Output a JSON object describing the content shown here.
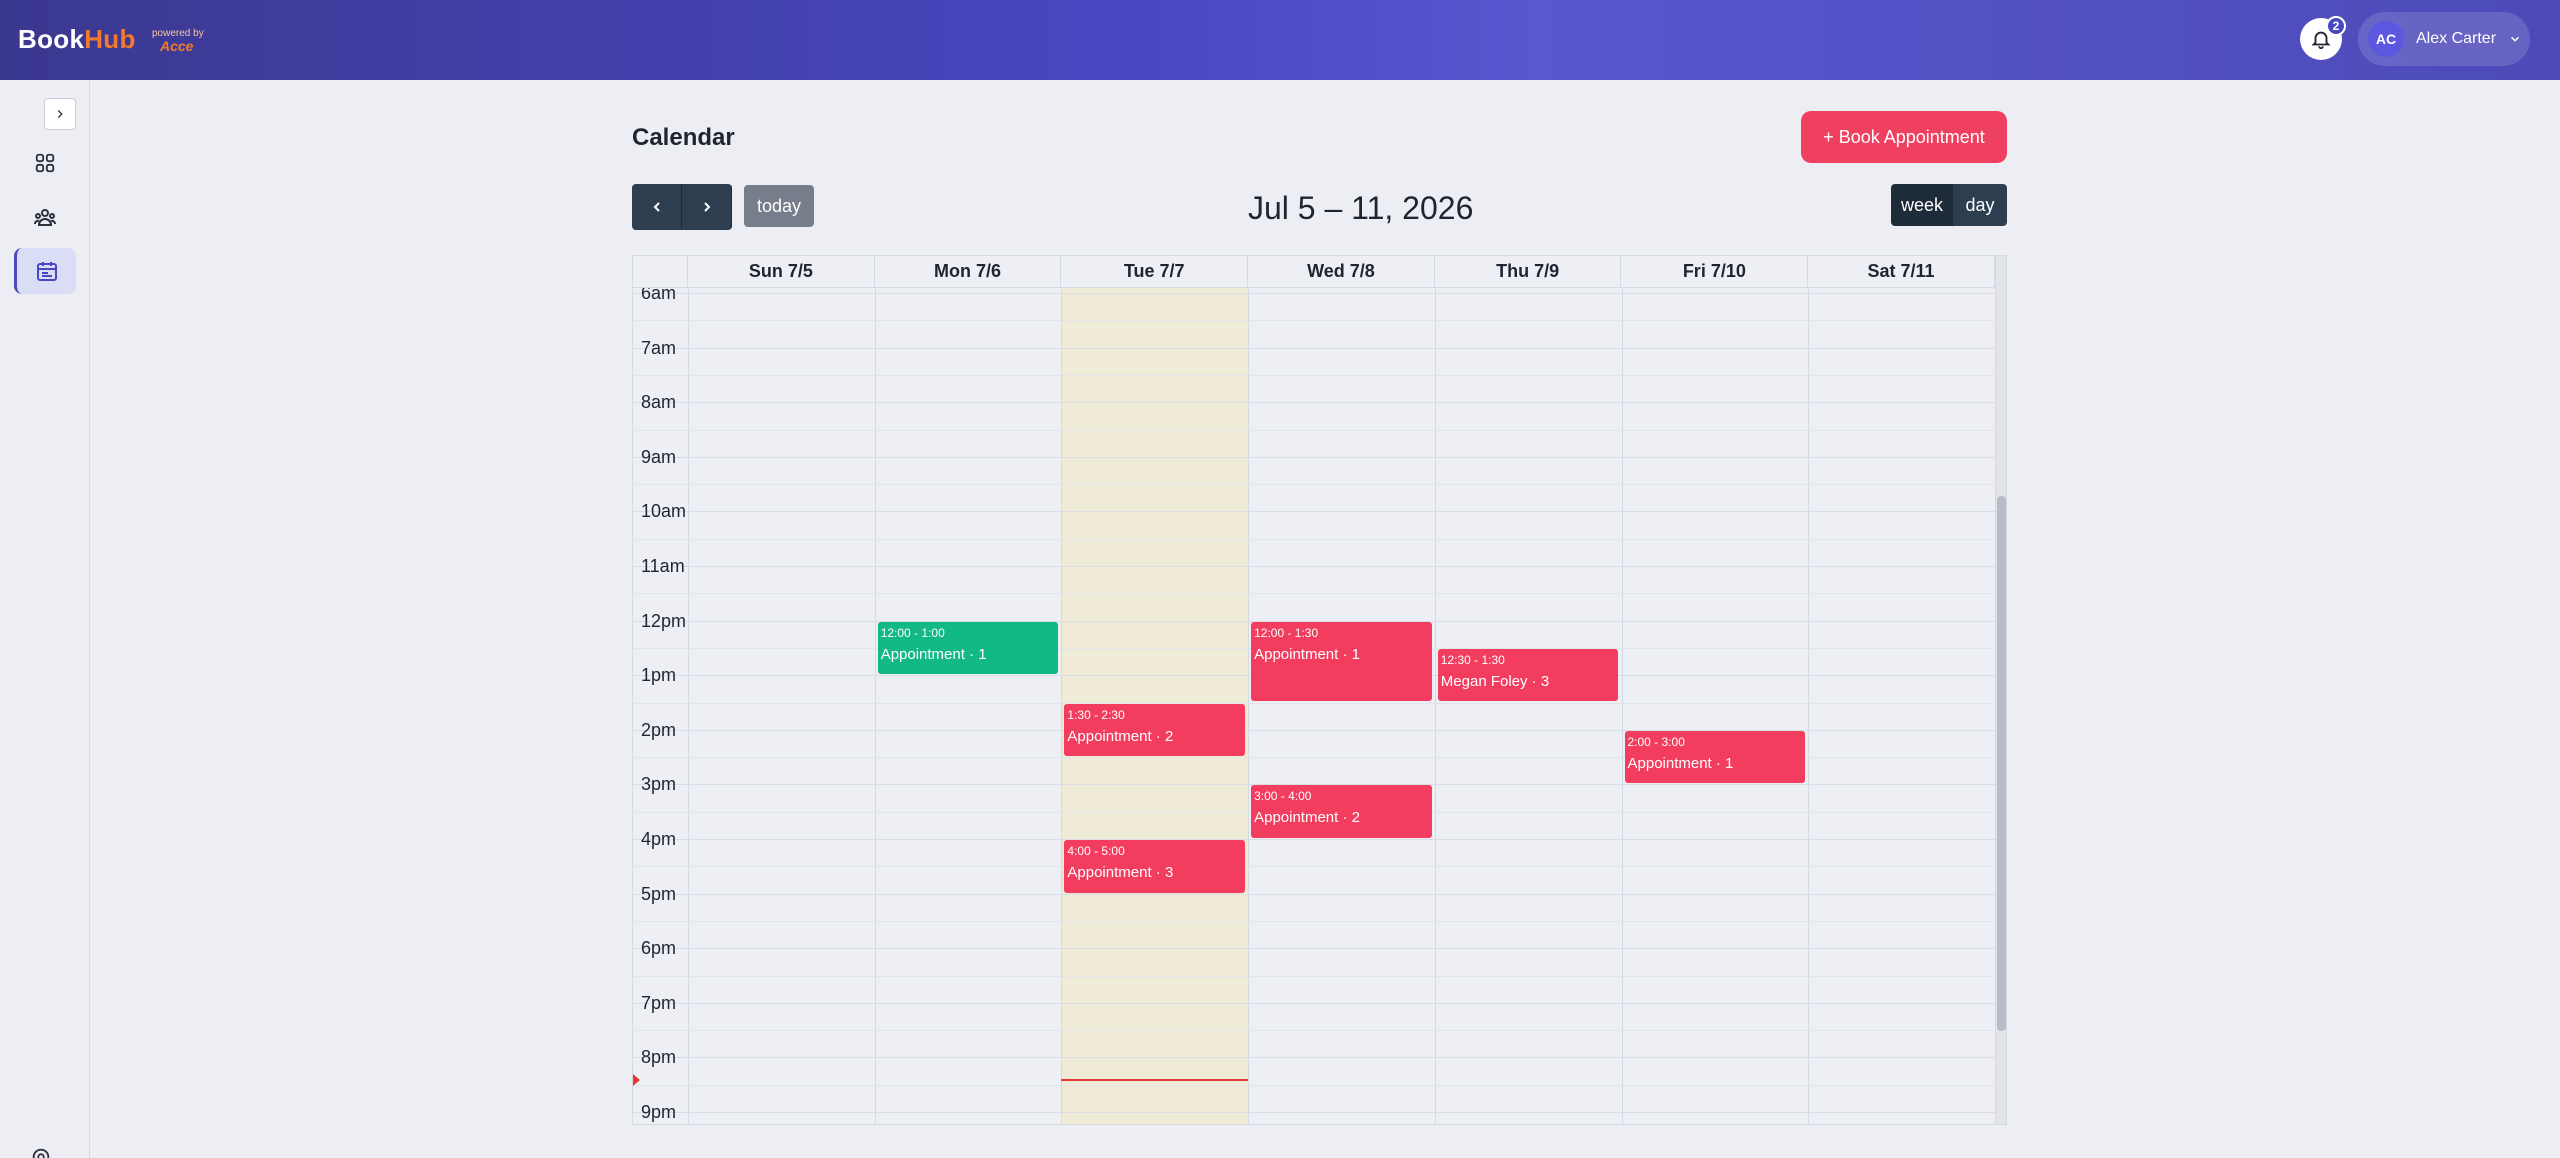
{
  "header": {
    "brand_main": "Book",
    "brand_accent": "Hub",
    "brand_sub": "powered by",
    "brand_mark": "Acce",
    "notification_count": "2",
    "user_initials": "AC",
    "user_name": "Alex Carter"
  },
  "page": {
    "title": "Calendar",
    "book_button": "+ Book Appointment",
    "today_button": "today",
    "range_title": "Jul 5 – 11, 2026",
    "view_week": "week",
    "view_day": "day"
  },
  "calendar": {
    "days": [
      "Sun 7/5",
      "Mon 7/6",
      "Tue 7/7",
      "Wed 7/8",
      "Thu 7/9",
      "Fri 7/10",
      "Sat 7/11"
    ],
    "today_index": 2,
    "hours": [
      "6am",
      "7am",
      "8am",
      "9am",
      "10am",
      "11am",
      "12pm",
      "1pm",
      "2pm",
      "3pm",
      "4pm",
      "5pm",
      "6pm",
      "7pm",
      "8pm",
      "9pm"
    ],
    "now_hour": 20.4,
    "events": [
      {
        "day": 1,
        "start": 12.0,
        "end": 13.0,
        "time": "12:00 - 1:00",
        "title": "Appointment · 1",
        "color": "green"
      },
      {
        "day": 2,
        "start": 13.5,
        "end": 14.5,
        "time": "1:30 - 2:30",
        "title": "Appointment · 2",
        "color": "red"
      },
      {
        "day": 2,
        "start": 16.0,
        "end": 17.0,
        "time": "4:00 - 5:00",
        "title": "Appointment · 3",
        "color": "red"
      },
      {
        "day": 3,
        "start": 12.0,
        "end": 13.5,
        "time": "12:00 - 1:30",
        "title": "Appointment · 1",
        "color": "red"
      },
      {
        "day": 3,
        "start": 15.0,
        "end": 16.0,
        "time": "3:00 - 4:00",
        "title": "Appointment · 2",
        "color": "red"
      },
      {
        "day": 4,
        "start": 12.5,
        "end": 13.5,
        "time": "12:30 - 1:30",
        "title": "Megan Foley · 3",
        "color": "red"
      },
      {
        "day": 5,
        "start": 14.0,
        "end": 15.0,
        "time": "2:00 - 3:00",
        "title": "Appointment · 1",
        "color": "red"
      }
    ]
  },
  "colors": {
    "accent": "#4a47c2",
    "event_red": "#f23d5e",
    "event_green": "#12b886",
    "today_bg": "#efebd6"
  }
}
